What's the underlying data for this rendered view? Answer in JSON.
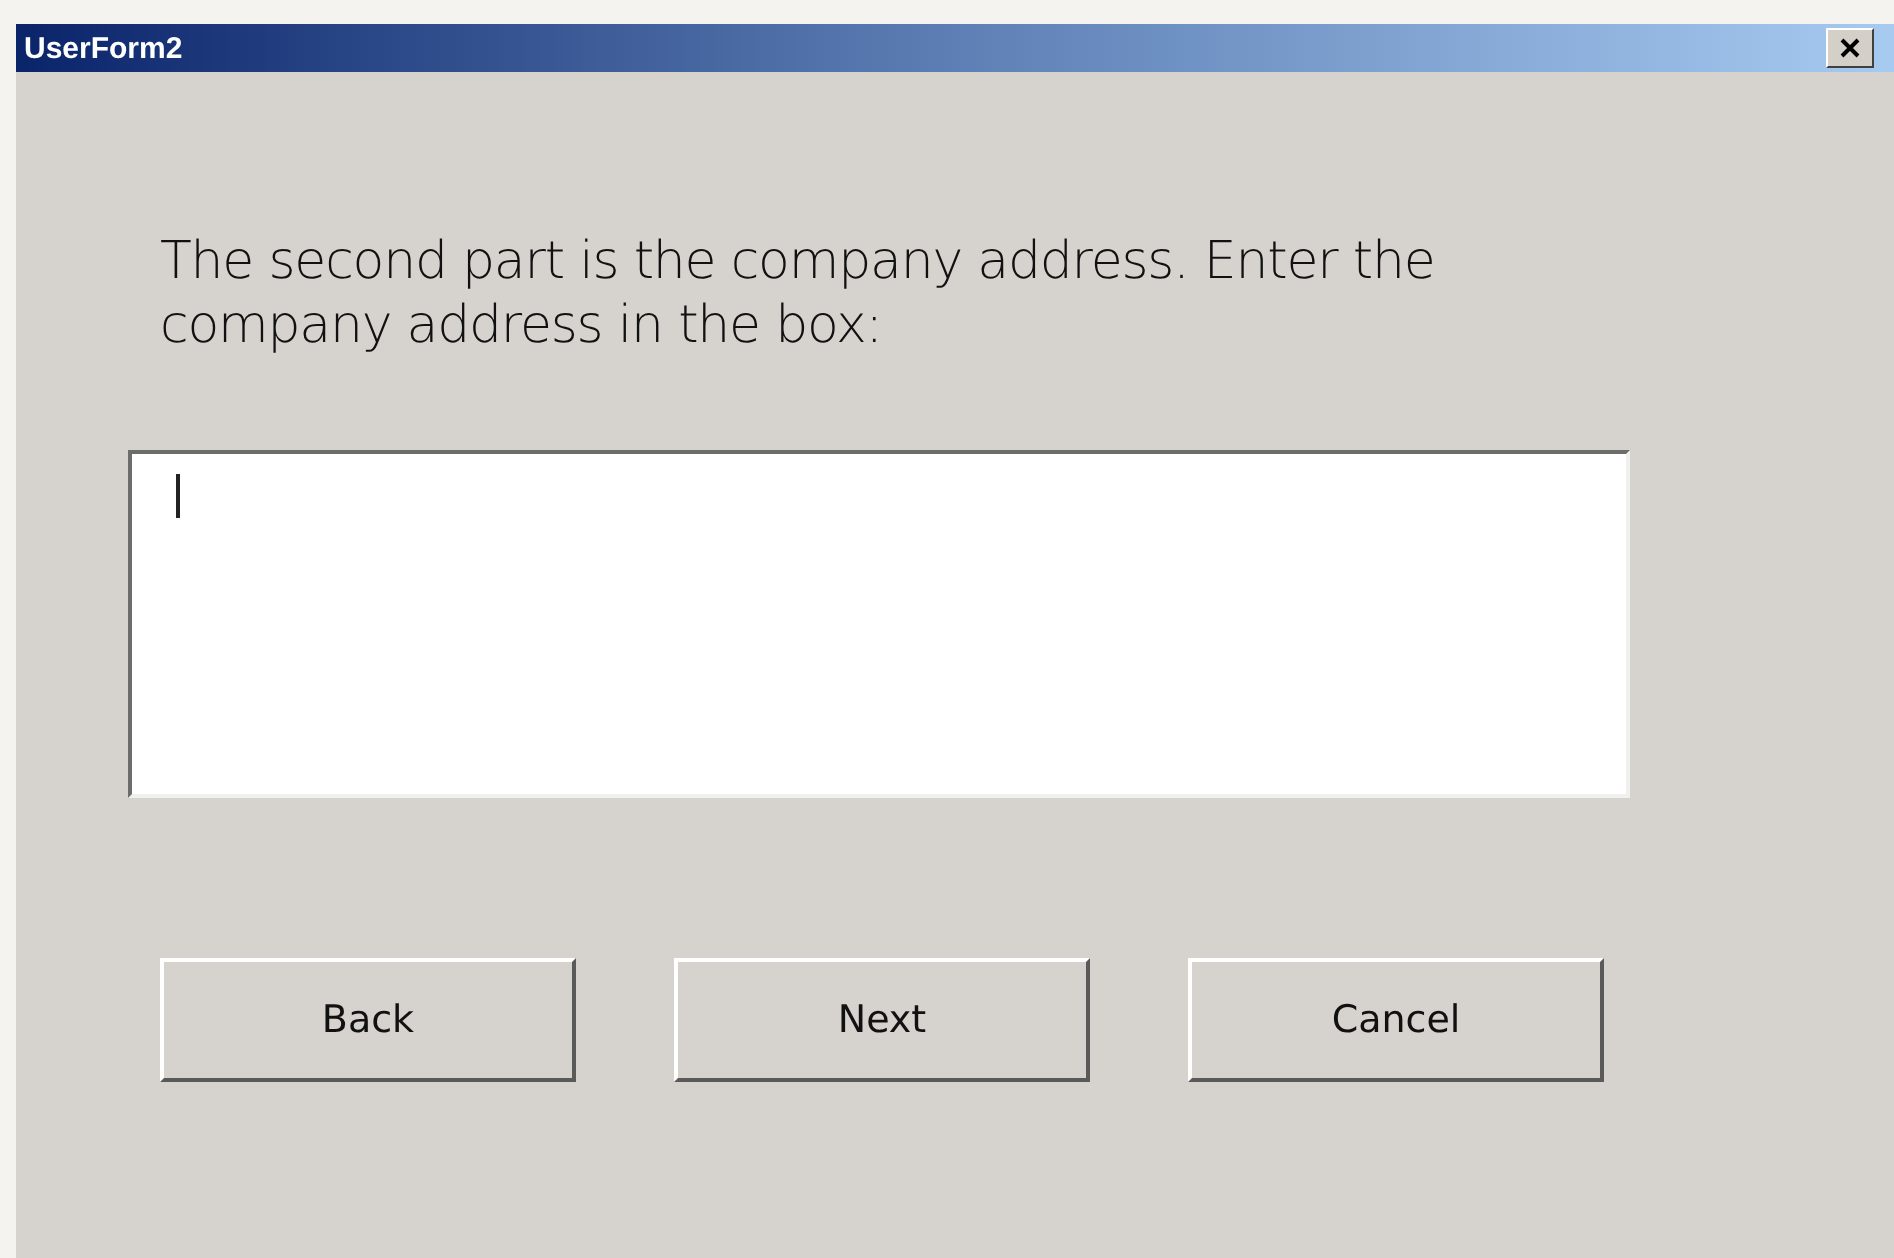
{
  "window": {
    "title": "UserForm2"
  },
  "prompt": "The second part is the company address. Enter the company address in the box:",
  "buttons": [
    {
      "label": "Back"
    },
    {
      "label": "Next"
    },
    {
      "label": "Cancel"
    }
  ]
}
